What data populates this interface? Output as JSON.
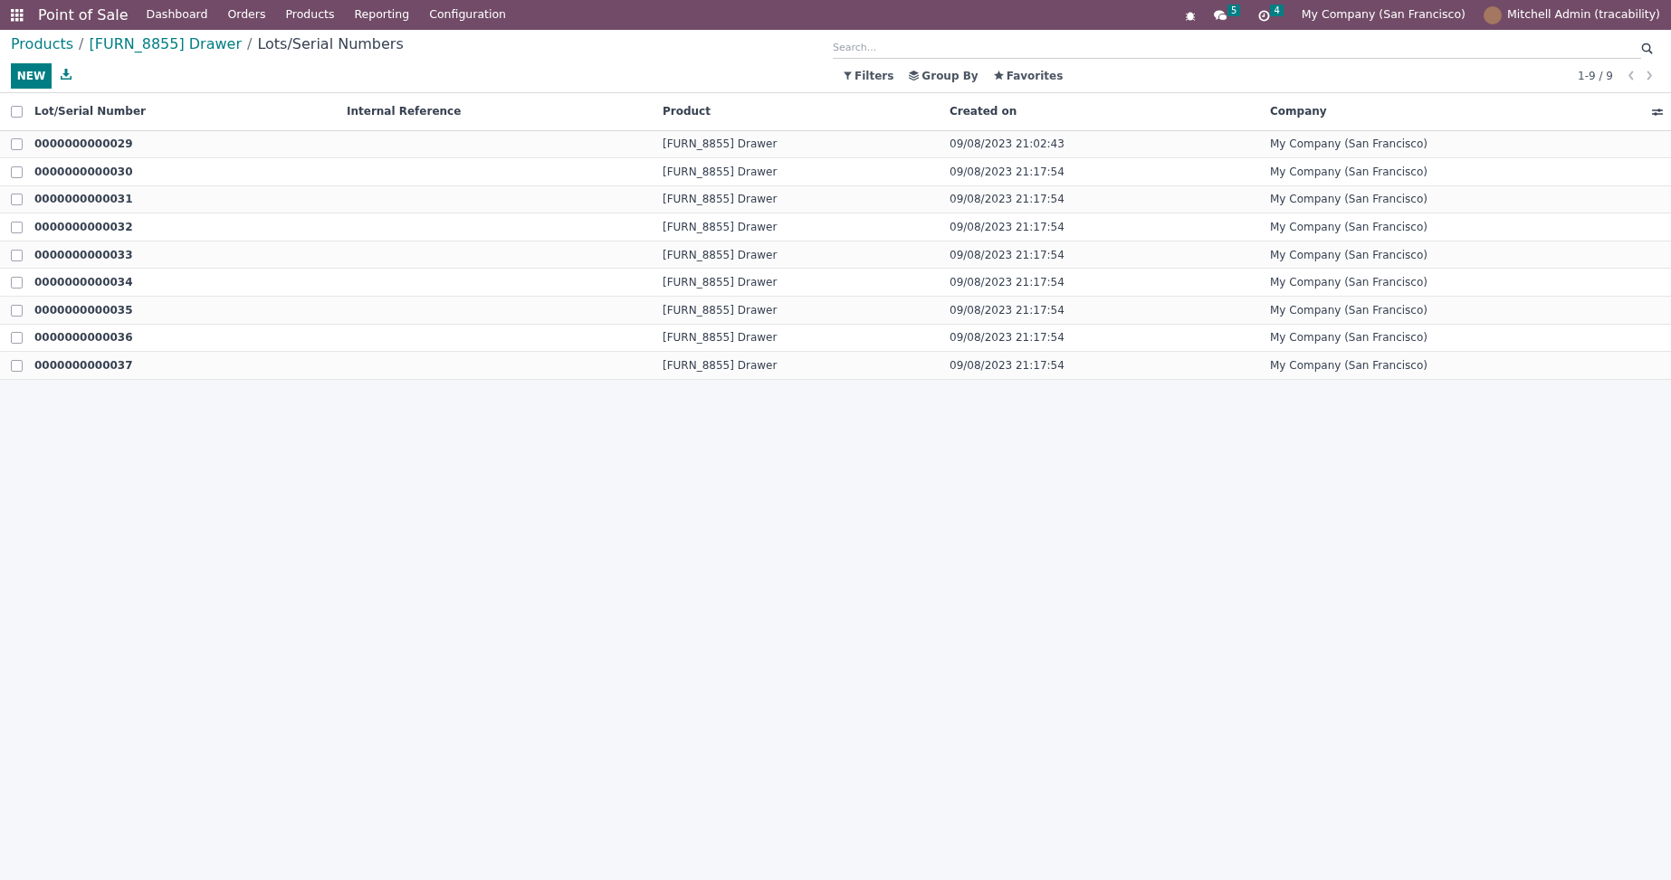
{
  "navbar": {
    "app_name": "Point of Sale",
    "menu": [
      "Dashboard",
      "Orders",
      "Products",
      "Reporting",
      "Configuration"
    ],
    "messages_count": "5",
    "activities_count": "4",
    "company": "My Company (San Francisco)",
    "user": "Mitchell Admin (tracability)"
  },
  "breadcrumbs": [
    "Products",
    "[FURN_8855] Drawer",
    "Lots/Serial Numbers"
  ],
  "breadcrumb_separator": "/",
  "search": {
    "placeholder": "Search..."
  },
  "new_button": "NEW",
  "filters": [
    "Filters",
    "Group By",
    "Favorites"
  ],
  "pager": "1-9 / 9",
  "table": {
    "select_all_checked": false,
    "columns": [
      "Lot/Serial Number",
      "Internal Reference",
      "Product",
      "Created on",
      "Company"
    ],
    "rows": [
      {
        "checked": false,
        "lot": "0000000000029",
        "product": "[FURN_8855] Drawer",
        "created_on": "09/08/2023 21:02:43",
        "company": "My Company (San Francisco)"
      },
      {
        "checked": false,
        "lot": "0000000000030",
        "product": "[FURN_8855] Drawer",
        "created_on": "09/08/2023 21:17:54",
        "company": "My Company (San Francisco)"
      },
      {
        "checked": false,
        "lot": "0000000000031",
        "product": "[FURN_8855] Drawer",
        "created_on": "09/08/2023 21:17:54",
        "company": "My Company (San Francisco)"
      },
      {
        "checked": false,
        "lot": "0000000000032",
        "product": "[FURN_8855] Drawer",
        "created_on": "09/08/2023 21:17:54",
        "company": "My Company (San Francisco)"
      },
      {
        "checked": false,
        "lot": "0000000000033",
        "product": "[FURN_8855] Drawer",
        "created_on": "09/08/2023 21:17:54",
        "company": "My Company (San Francisco)"
      },
      {
        "checked": false,
        "lot": "0000000000034",
        "product": "[FURN_8855] Drawer",
        "created_on": "09/08/2023 21:17:54",
        "company": "My Company (San Francisco)"
      },
      {
        "checked": false,
        "lot": "0000000000035",
        "product": "[FURN_8855] Drawer",
        "created_on": "09/08/2023 21:17:54",
        "company": "My Company (San Francisco)"
      },
      {
        "checked": false,
        "lot": "0000000000036",
        "product": "[FURN_8855] Drawer",
        "created_on": "09/08/2023 21:17:54",
        "company": "My Company (San Francisco)"
      },
      {
        "checked": false,
        "lot": "0000000000037",
        "product": "[FURN_8855] Drawer",
        "created_on": "09/08/2023 21:17:54",
        "company": "My Company (San Francisco)"
      }
    ]
  }
}
